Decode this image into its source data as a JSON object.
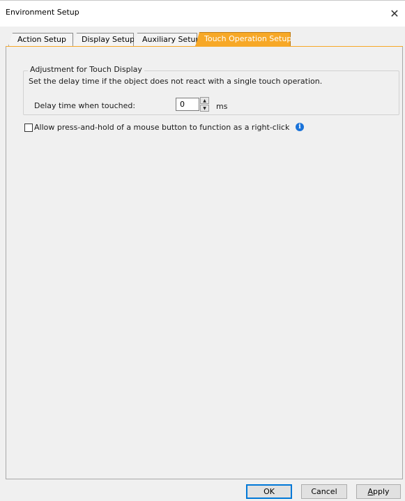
{
  "window": {
    "title": "Environment Setup",
    "close_glyph": "✕"
  },
  "tabs": [
    {
      "label": "Action Setup",
      "active": false
    },
    {
      "label": "Display Setup",
      "active": false
    },
    {
      "label": "Auxiliary Setup",
      "active": false
    },
    {
      "label": "Touch Operation Setup",
      "active": true
    }
  ],
  "touch_display": {
    "legend": "Adjustment for Touch Display",
    "description": "Set the delay time if the object does not react with a single touch operation.",
    "delay_label": "Delay time when touched:",
    "delay_value": "0",
    "unit": "ms"
  },
  "right_click_option": {
    "label": "Allow press-and-hold of a mouse button to function as a right-click",
    "checked": false,
    "info_icon": "info-icon"
  },
  "buttons": {
    "ok": "OK",
    "cancel": "Cancel",
    "apply_accel": "A",
    "apply_rest": "pply"
  },
  "colors": {
    "active_tab": "#f7a827",
    "background": "#f0f0f0",
    "info_icon": "#1a73d9"
  }
}
